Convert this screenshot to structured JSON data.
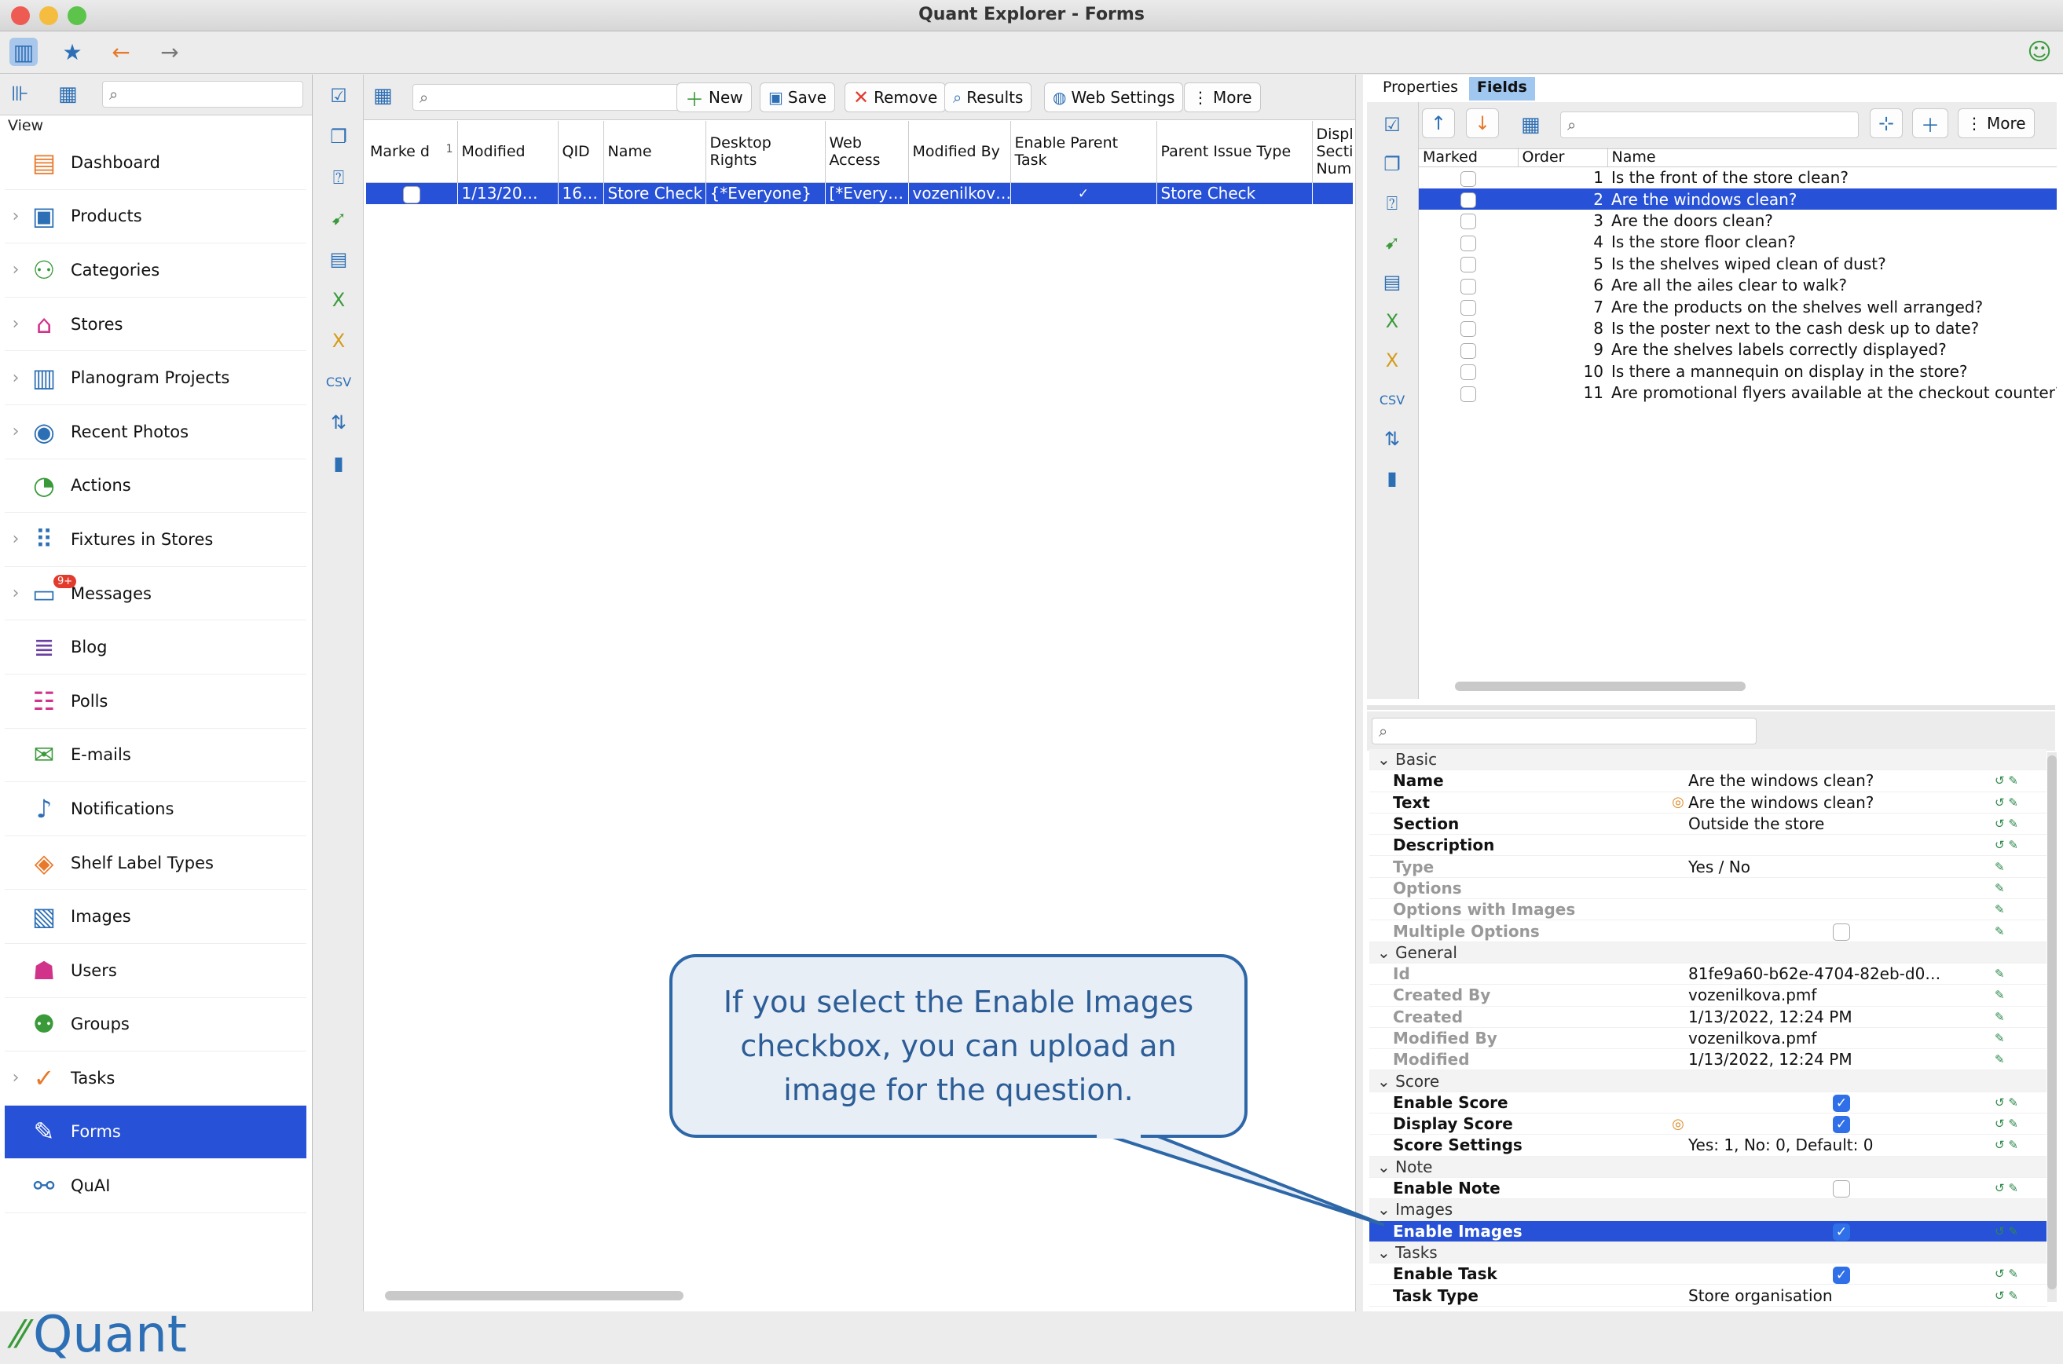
{
  "window": {
    "title": "Quant Explorer - Forms"
  },
  "nav": {
    "view_label": "View",
    "items": [
      {
        "label": "Dashboard",
        "icon": "dashboard-icon",
        "chev": false
      },
      {
        "label": "Products",
        "icon": "products-icon",
        "chev": true
      },
      {
        "label": "Categories",
        "icon": "categories-icon",
        "chev": true
      },
      {
        "label": "Stores",
        "icon": "stores-icon",
        "chev": true
      },
      {
        "label": "Planogram Projects",
        "icon": "planogram-icon",
        "chev": true
      },
      {
        "label": "Recent Photos",
        "icon": "camera-icon",
        "chev": true
      },
      {
        "label": "Actions",
        "icon": "actions-icon",
        "chev": false
      },
      {
        "label": "Fixtures in Stores",
        "icon": "fixtures-icon",
        "chev": true
      },
      {
        "label": "Messages",
        "icon": "messages-icon",
        "chev": true,
        "badge": "9+"
      },
      {
        "label": "Blog",
        "icon": "blog-icon",
        "chev": false
      },
      {
        "label": "Polls",
        "icon": "polls-icon",
        "chev": false
      },
      {
        "label": "E-mails",
        "icon": "email-icon",
        "chev": false
      },
      {
        "label": "Notifications",
        "icon": "notifications-icon",
        "chev": false
      },
      {
        "label": "Shelf Label Types",
        "icon": "shelf-label-icon",
        "chev": false
      },
      {
        "label": "Images",
        "icon": "images-icon",
        "chev": false
      },
      {
        "label": "Users",
        "icon": "users-icon",
        "chev": false
      },
      {
        "label": "Groups",
        "icon": "groups-icon",
        "chev": false
      },
      {
        "label": "Tasks",
        "icon": "tasks-icon",
        "chev": true
      },
      {
        "label": "Forms",
        "icon": "forms-icon",
        "chev": false,
        "selected": true
      },
      {
        "label": "QuAI",
        "icon": "quai-icon",
        "chev": false
      }
    ],
    "logo_text": "Quant"
  },
  "center": {
    "buttons": {
      "new": "New",
      "save": "Save",
      "remove": "Remove",
      "results": "Results",
      "web_settings": "Web Settings",
      "more": "More"
    },
    "columns": [
      "Marke d",
      "Modified",
      "QID",
      "Name",
      "Desktop Rights",
      "Web Access",
      "Modified By",
      "Enable Parent Task",
      "Parent Issue Type",
      "Displ Sectic Numb"
    ],
    "sort_index": "1",
    "row": {
      "modified": "1/13/20…",
      "qid": "16…",
      "name": "Store Check",
      "desktop_rights": "{*Everyone}",
      "web_access": "[*Every…",
      "modified_by": "vozenilkov…",
      "parent_issue_type": "Store Check"
    }
  },
  "right": {
    "tabs": {
      "properties": "Properties",
      "fields": "Fields"
    },
    "more": "More",
    "columns": {
      "marked": "Marked",
      "order": "Order",
      "name": "Name"
    },
    "fields": [
      {
        "order": "1",
        "name": "Is the front of the store clean?"
      },
      {
        "order": "2",
        "name": "Are the windows clean?",
        "selected": true
      },
      {
        "order": "3",
        "name": "Are the doors clean?"
      },
      {
        "order": "4",
        "name": "Is the store floor clean?"
      },
      {
        "order": "5",
        "name": "Is the shelves wiped clean of dust?"
      },
      {
        "order": "6",
        "name": "Are all the ailes clear to walk?"
      },
      {
        "order": "7",
        "name": "Are the products on the shelves well arranged?"
      },
      {
        "order": "8",
        "name": "Is the poster next to the cash desk up to date?"
      },
      {
        "order": "9",
        "name": "Are the shelves labels correctly displayed?"
      },
      {
        "order": "10",
        "name": "Is there a mannequin on display in the store?"
      },
      {
        "order": "11",
        "name": "Are promotional flyers available at the checkout counter?"
      }
    ]
  },
  "props": [
    {
      "type": "section",
      "key": "Basic"
    },
    {
      "key": "Name",
      "value": "Are the windows clean?",
      "bold": true
    },
    {
      "key": "Text",
      "value": "Are the windows clean?",
      "bold": true,
      "mark": true
    },
    {
      "key": "Section",
      "value": "Outside the store",
      "bold": true
    },
    {
      "key": "Description",
      "value": "",
      "bold": true
    },
    {
      "key": "Type",
      "value": "Yes / No",
      "dim": true
    },
    {
      "key": "Options",
      "value": "",
      "dim": true
    },
    {
      "key": "Options with Images",
      "value": "",
      "dim": true
    },
    {
      "key": "Multiple Options",
      "check": "off",
      "dim": true
    },
    {
      "type": "section",
      "key": "General"
    },
    {
      "key": "Id",
      "value": "81fe9a60-b62e-4704-82eb-d0…",
      "dim": true
    },
    {
      "key": "Created By",
      "value": "vozenilkova.pmf",
      "dim": true
    },
    {
      "key": "Created",
      "value": "1/13/2022, 12:24 PM",
      "dim": true
    },
    {
      "key": "Modified By",
      "value": "vozenilkova.pmf",
      "dim": true
    },
    {
      "key": "Modified",
      "value": "1/13/2022, 12:24 PM",
      "dim": true
    },
    {
      "type": "section",
      "key": "Score"
    },
    {
      "key": "Enable Score",
      "check": "on",
      "bold": true
    },
    {
      "key": "Display Score",
      "check": "on",
      "bold": true,
      "mark": true
    },
    {
      "key": "Score Settings",
      "value": "Yes: 1, No: 0, Default: 0",
      "bold": true
    },
    {
      "type": "section",
      "key": "Note"
    },
    {
      "key": "Enable Note",
      "check": "off",
      "bold": true
    },
    {
      "type": "section",
      "key": "Images"
    },
    {
      "key": "Enable Images",
      "check": "on",
      "bold": true,
      "selected": true
    },
    {
      "type": "section",
      "key": "Tasks"
    },
    {
      "key": "Enable Task",
      "check": "on",
      "bold": true
    },
    {
      "key": "Task Type",
      "value": "Store organisation",
      "bold": true
    }
  ],
  "callout": {
    "text": "If you select the Enable Images checkbox, you can upload an image for the question."
  },
  "colors": {
    "accent": "#2751d6",
    "callout_border": "#2e67a8",
    "callout_text": "#2c5d96"
  }
}
